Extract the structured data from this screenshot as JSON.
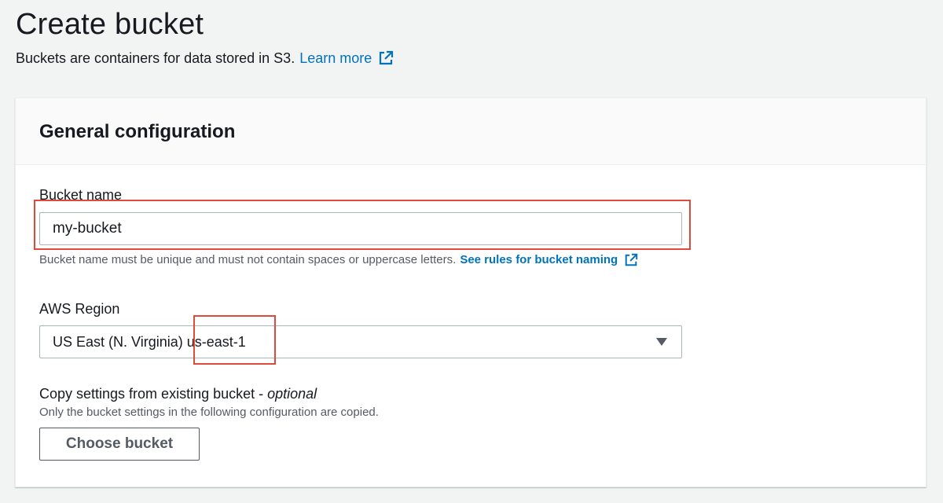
{
  "header": {
    "title": "Create bucket",
    "subtitle": "Buckets are containers for data stored in S3.",
    "learn_more": "Learn more"
  },
  "general_configuration": {
    "title": "General configuration",
    "bucket_name": {
      "label": "Bucket name",
      "value": "my-bucket",
      "hint": "Bucket name must be unique and must not contain spaces or uppercase letters.",
      "rules_link": "See rules for bucket naming"
    },
    "region": {
      "label": "AWS Region",
      "selected_name": "US East (N. Virginia)",
      "selected_code": "us-east-1"
    },
    "copy_settings": {
      "label": "Copy settings from existing bucket - ",
      "optional": "optional",
      "description": "Only the bucket settings in the following configuration are copied.",
      "button": "Choose bucket"
    }
  },
  "icons": {
    "external_link": "external-link-icon",
    "dropdown": "caret-down-icon"
  },
  "colors": {
    "link": "#0073bb",
    "highlight": "#e04a3a",
    "background": "#f2f3f3"
  }
}
